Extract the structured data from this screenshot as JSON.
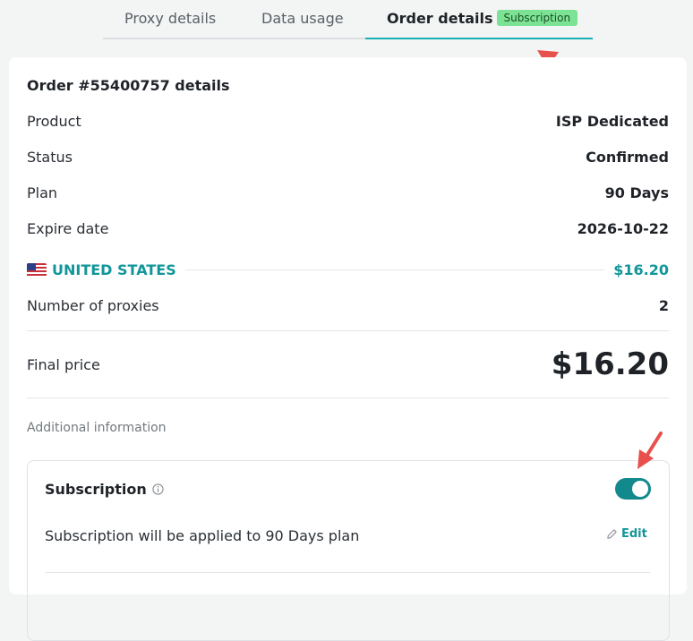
{
  "tabs": {
    "proxy_details": "Proxy details",
    "data_usage": "Data usage",
    "order_details": "Order details",
    "badge": "Subscription"
  },
  "order": {
    "title": "Order #55400757 details",
    "rows": [
      {
        "label": "Product",
        "value": "ISP Dedicated"
      },
      {
        "label": "Status",
        "value": "Confirmed"
      },
      {
        "label": "Plan",
        "value": "90 Days"
      },
      {
        "label": "Expire date",
        "value": "2026-10-22"
      }
    ],
    "country": {
      "name": "UNITED STATES",
      "price": "$16.20",
      "flag_icon": "us-flag-icon"
    },
    "proxies": {
      "label": "Number of proxies",
      "value": "2"
    },
    "final": {
      "label": "Final price",
      "value": "$16.20"
    }
  },
  "additional": {
    "heading": "Additional information",
    "subscription": {
      "title": "Subscription",
      "enabled": true,
      "description": "Subscription will be applied to 90 Days plan",
      "edit_label": "Edit"
    }
  },
  "colors": {
    "accent": "#12969a",
    "toggle": "#12898d",
    "badge_bg": "#7de394",
    "arrow": "#e8504e"
  }
}
